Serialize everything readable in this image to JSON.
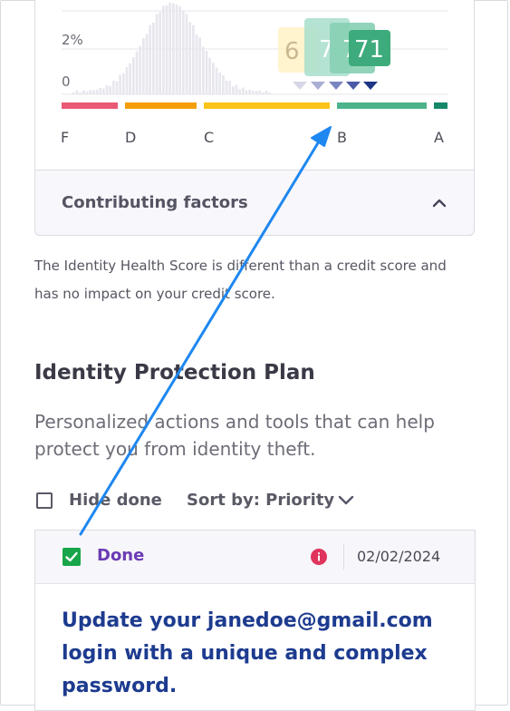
{
  "chart_data": {
    "type": "bar",
    "y_tick_labels": [
      "2%",
      "0"
    ],
    "grade_labels": [
      "F",
      "D",
      "C",
      "B",
      "A"
    ],
    "grade_colors": [
      "#ea5a74",
      "#f59e0b",
      "#fcc419",
      "#4db38a",
      "#16886a"
    ],
    "score_badges": [
      "6",
      "7",
      "7",
      "71"
    ],
    "current_score": "71"
  },
  "factors": {
    "label": "Contributing factors"
  },
  "disclaimer": "The Identity Health Score is different than a credit score and has no impact on your credit score.",
  "plan": {
    "title": "Identity Protection Plan",
    "subtitle": "Personalized actions and tools that can help protect you from identity theft."
  },
  "controls": {
    "hide_done_label": "Hide done",
    "sort_label": "Sort by: Priority"
  },
  "task": {
    "status": "Done",
    "date": "02/02/2024",
    "title": "Update your janedoe@gmail.com login with a unique and complex password."
  },
  "colors": {
    "accent_blue": "#1e87f0",
    "done_purple": "#6b3bb4",
    "task_title_blue": "#1d3b8f",
    "check_green": "#19a64a",
    "info_red": "#e0345c"
  }
}
